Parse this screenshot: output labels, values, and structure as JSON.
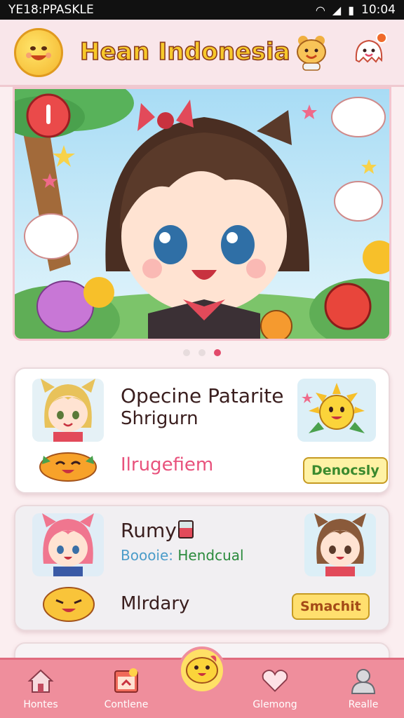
{
  "status_bar": {
    "left_text": "YE18:PPASKLE",
    "time": "10:04"
  },
  "header": {
    "title": "Hean Indonesia",
    "logo_icon": "smiley-mascot-icon",
    "mascot_a_icon": "bear-mascot-icon",
    "mascot_b_icon": "ghost-mascot-icon"
  },
  "banner": {
    "slides": 3,
    "active_slide": 3
  },
  "cards": [
    {
      "title_line1": "Opecine Patarite",
      "title_line2": "Shrigurn",
      "subtitle": "Ilrugefiem",
      "button": "Denocsly"
    },
    {
      "title": "Rumy",
      "meta_label": "Boooie:",
      "meta_value": "Hendcual",
      "subtitle": "Mlrdary",
      "button": "Smachit"
    }
  ],
  "nav": {
    "items": [
      {
        "label": "Hontes",
        "icon": "home-icon"
      },
      {
        "label": "Contlene",
        "icon": "calendar-icon"
      },
      {
        "label": "Glemong",
        "icon": "heart-icon"
      },
      {
        "label": "Realle",
        "icon": "user-icon"
      }
    ],
    "center_icon": "bird-mascot-icon"
  },
  "colors": {
    "accent_pink": "#e24a6b",
    "nav_bg": "#ef8e9c",
    "title_yellow": "#f7c92b"
  }
}
